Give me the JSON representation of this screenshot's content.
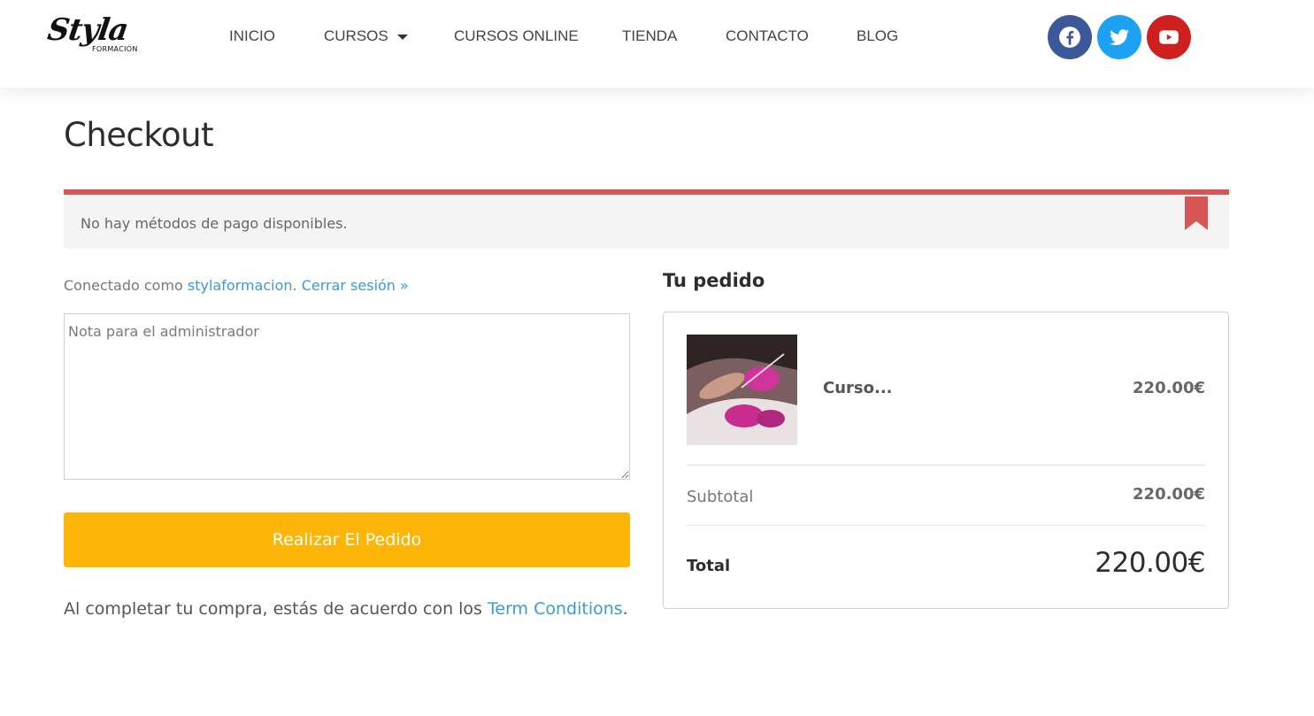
{
  "header": {
    "logo": {
      "main": "Styla",
      "sub": "FORMACIÓN"
    },
    "nav": [
      {
        "label": "INICIO"
      },
      {
        "label": "CURSOS",
        "has_dropdown": true
      },
      {
        "label": "CURSOS ONLINE"
      },
      {
        "label": "TIENDA"
      },
      {
        "label": "CONTACTO"
      },
      {
        "label": "BLOG"
      }
    ],
    "social": [
      {
        "icon": "facebook-icon",
        "color": "#3b5998"
      },
      {
        "icon": "twitter-icon",
        "color": "#1da1f2"
      },
      {
        "icon": "youtube-icon",
        "color": "#cd201f"
      }
    ]
  },
  "page": {
    "title": "Checkout",
    "notice": {
      "text": "No hay métodos de pago disponibles.",
      "accent_color": "#d65656"
    },
    "connected": {
      "prefix": "Conectado como ",
      "username": "stylaformacion",
      "separator": ". ",
      "logout": "Cerrar sesión »"
    },
    "note_placeholder": "Nota para el administrador",
    "place_order_label": "Realizar El Pedido",
    "place_order_color": "#fdb607",
    "terms": {
      "prefix": "Al completar tu compra, estás de acuerdo con los ",
      "link": "Term Conditions",
      "suffix": "."
    }
  },
  "order": {
    "heading": "Tu pedido",
    "item": {
      "name": "Curso...",
      "price": "220.00€"
    },
    "subtotal_label": "Subtotal",
    "subtotal_value": "220.00€",
    "total_label": "Total",
    "total_value": "220.00€"
  }
}
